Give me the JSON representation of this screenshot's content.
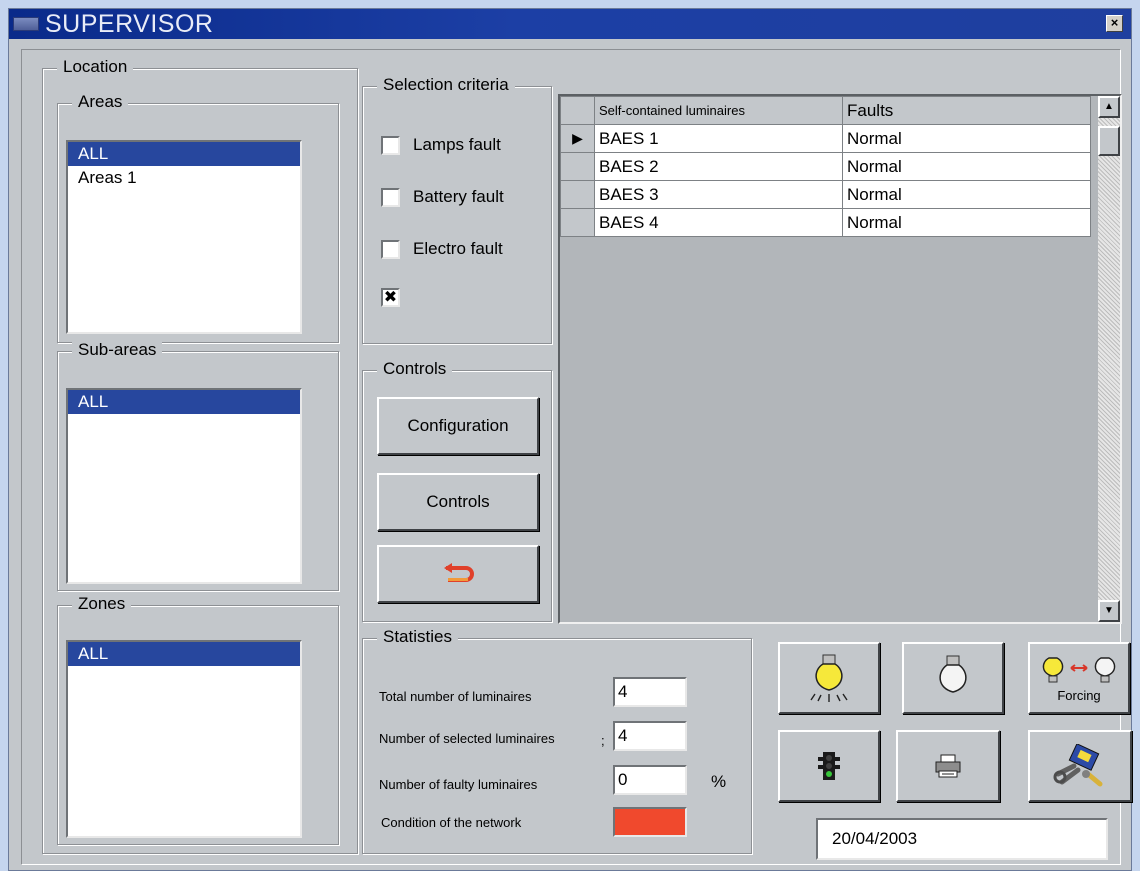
{
  "window": {
    "title": "SUPERVISOR",
    "close_glyph": "×"
  },
  "location": {
    "label": "Location",
    "areas": {
      "label": "Areas",
      "items": [
        "ALL",
        "Areas 1"
      ],
      "selected": "ALL"
    },
    "sub_areas": {
      "label": "Sub-areas",
      "items": [
        "ALL"
      ],
      "selected": "ALL"
    },
    "zones": {
      "label": "Zones",
      "items": [
        "ALL"
      ],
      "selected": "ALL"
    }
  },
  "selection_criteria": {
    "label": "Selection criteria",
    "options": [
      {
        "label": "Lamps fault",
        "checked": false
      },
      {
        "label": "Battery fault",
        "checked": false
      },
      {
        "label": "Electro fault",
        "checked": false
      },
      {
        "label": "",
        "checked": true,
        "mark": "✖"
      }
    ]
  },
  "controls": {
    "label": "Controls",
    "configuration_label": "Configuration",
    "controls_label": "Controls",
    "back_icon": "return-arrow-icon"
  },
  "luminaires_table": {
    "columns": [
      "Self-contained luminaires",
      "Faults"
    ],
    "current_row_marker": "▶",
    "rows": [
      {
        "name": "BAES 1",
        "fault": "Normal"
      },
      {
        "name": "BAES 2",
        "fault": "Normal"
      },
      {
        "name": "BAES 3",
        "fault": "Normal"
      },
      {
        "name": "BAES 4",
        "fault": "Normal"
      }
    ],
    "scroll_up": "▲",
    "scroll_down": "▼"
  },
  "statistics": {
    "label": "Statisties",
    "total_label": "Total number of luminaires",
    "total_value": "4",
    "selected_label": "Number of selected luminaires",
    "selected_marker": ";",
    "selected_value": "4",
    "faulty_label": "Number of faulty luminaires",
    "faulty_value": "0",
    "faulty_unit": "%",
    "condition_label": "Condition of the network",
    "condition_color": "#f0492d"
  },
  "action_buttons": {
    "forcing_label": "Forcing",
    "icons": [
      "lit-bulb-icon",
      "unlit-bulb-icon",
      "forcing-bulbs-icon",
      "traffic-light-icon",
      "printer-icon",
      "tools-icon"
    ]
  },
  "date": "20/04/2003",
  "colors": {
    "selection": "#27479e",
    "title_bar": "#0a2a8a",
    "face": "#c3c7cb"
  }
}
